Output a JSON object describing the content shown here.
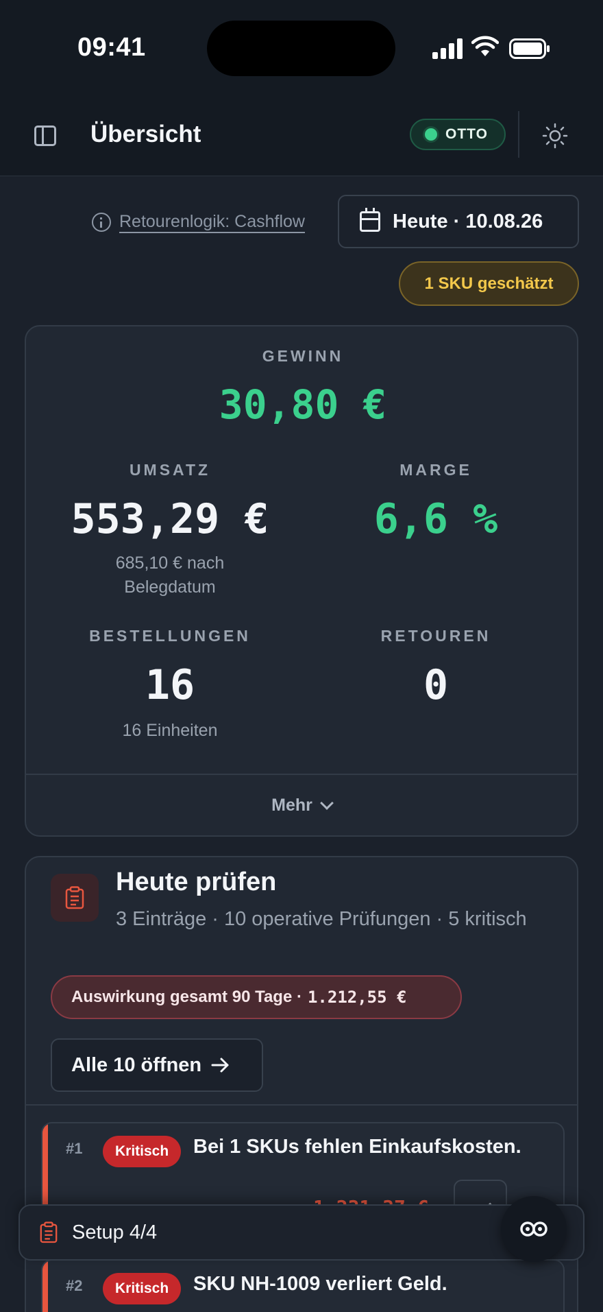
{
  "status_bar": {
    "time": "09:41"
  },
  "header": {
    "title": "Übersicht",
    "marketplace_badge": "OTTO",
    "sidebar_icon": "sidebar-toggle-icon",
    "theme_icon": "sun-icon"
  },
  "controls": {
    "return_logic_link": "Retourenlogik: Cashflow",
    "date_button": "Heute · 10.08.26",
    "estimate_badge": "1 SKU geschätzt"
  },
  "kpis": {
    "profit": {
      "label": "GEWINN",
      "value": "30,80 €"
    },
    "revenue": {
      "label": "UMSATZ",
      "value": "553,29 €",
      "note": "685,10 € nach Belegdatum"
    },
    "margin": {
      "label": "MARGE",
      "value": "6,6 %"
    },
    "orders": {
      "label": "BESTELLUNGEN",
      "value": "16",
      "note": "16 Einheiten"
    },
    "returns": {
      "label": "RETOUREN",
      "value": "0"
    },
    "more_button": "Mehr"
  },
  "review": {
    "title": "Heute prüfen",
    "subtitle": "3 Einträge · 10 operative Prüfungen · 5 kritisch",
    "impact_label": "Auswirkung gesamt 90 Tage ·",
    "impact_value": "1.212,55 €",
    "open_all_button": "Alle 10 öffnen",
    "items": [
      {
        "num": "#1",
        "severity": "Kritisch",
        "text": "Bei 1 SKUs fehlen Einkaufskosten.",
        "amount": "1.231,37 €"
      },
      {
        "num": "#2",
        "severity": "Kritisch",
        "text": "SKU NH-1009 verliert Geld."
      }
    ]
  },
  "setup_bar": {
    "label": "Setup 4/4"
  },
  "colors": {
    "accent_green": "#3bd08d",
    "critical_red": "#c6282b",
    "warning_amber": "#f3c84b",
    "background": "#1b212b"
  }
}
